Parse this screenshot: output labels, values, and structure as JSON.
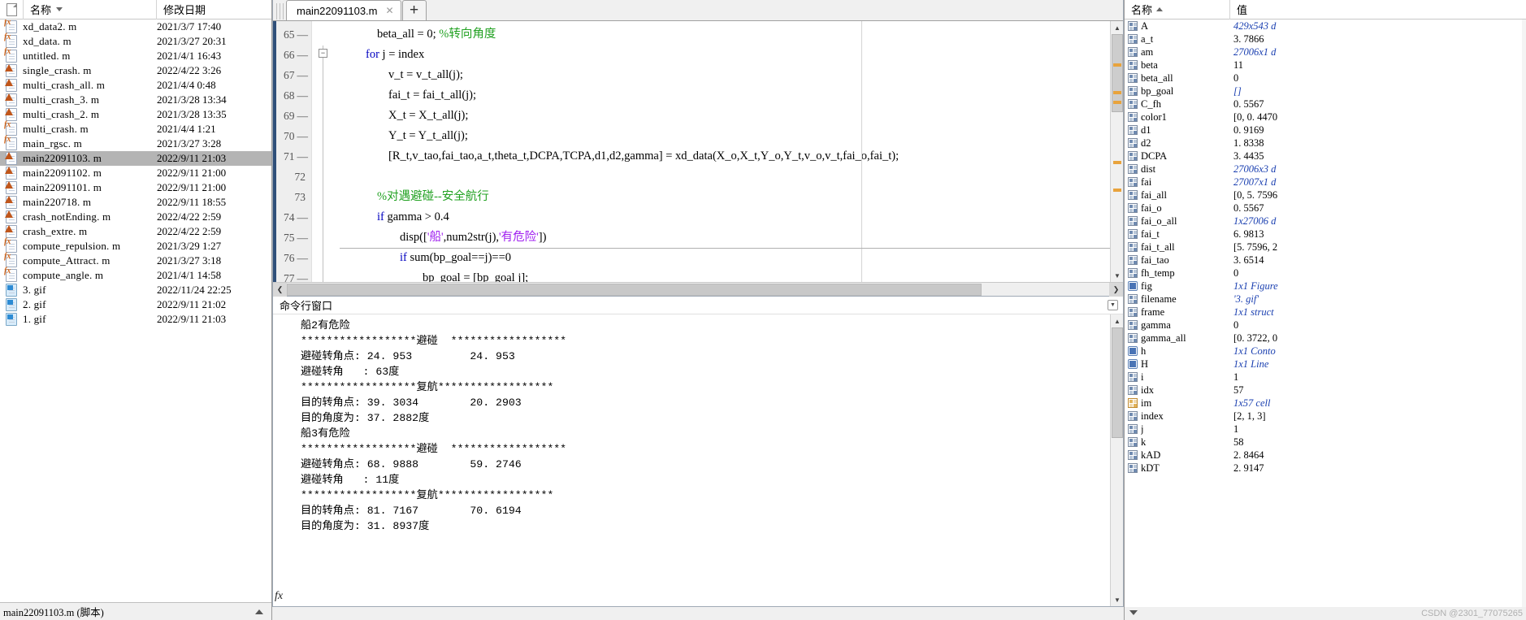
{
  "file_browser": {
    "columns": {
      "name": "名称",
      "date": "修改日期"
    },
    "files": [
      {
        "icon": "fx-file-icon",
        "name": "xd_data2. m",
        "date": "2021/3/7  17:40",
        "selected": false
      },
      {
        "icon": "fx-file-icon",
        "name": "xd_data. m",
        "date": "2021/3/27  20:31",
        "selected": false
      },
      {
        "icon": "fx-file-icon",
        "name": "untitled. m",
        "date": "2021/4/1  16:43",
        "selected": false
      },
      {
        "icon": "m-script-icon",
        "name": "single_crash. m",
        "date": "2022/4/22  3:26",
        "selected": false
      },
      {
        "icon": "m-script-icon",
        "name": "multi_crash_all. m",
        "date": "2021/4/4  0:48",
        "selected": false
      },
      {
        "icon": "m-script-icon",
        "name": "multi_crash_3. m",
        "date": "2021/3/28  13:34",
        "selected": false
      },
      {
        "icon": "m-script-icon",
        "name": "multi_crash_2. m",
        "date": "2021/3/28  13:35",
        "selected": false
      },
      {
        "icon": "fx-file-icon",
        "name": "multi_crash. m",
        "date": "2021/4/4  1:21",
        "selected": false
      },
      {
        "icon": "fx-file-icon",
        "name": "main_rgsc. m",
        "date": "2021/3/27  3:28",
        "selected": false
      },
      {
        "icon": "m-script-icon",
        "name": "main22091103. m",
        "date": "2022/9/11  21:03",
        "selected": true
      },
      {
        "icon": "m-script-icon",
        "name": "main22091102. m",
        "date": "2022/9/11  21:00",
        "selected": false
      },
      {
        "icon": "m-script-icon",
        "name": "main22091101. m",
        "date": "2022/9/11  21:00",
        "selected": false
      },
      {
        "icon": "m-script-icon",
        "name": "main220718. m",
        "date": "2022/9/11  18:55",
        "selected": false
      },
      {
        "icon": "m-script-icon",
        "name": "crash_notEnding. m",
        "date": "2022/4/22  2:59",
        "selected": false
      },
      {
        "icon": "m-script-icon",
        "name": "crash_extre. m",
        "date": "2022/4/22  2:59",
        "selected": false
      },
      {
        "icon": "fx-file-icon",
        "name": "compute_repulsion. m",
        "date": "2021/3/29  1:27",
        "selected": false
      },
      {
        "icon": "fx-file-icon",
        "name": "compute_Attract. m",
        "date": "2021/3/27  3:18",
        "selected": false
      },
      {
        "icon": "fx-file-icon",
        "name": "compute_angle. m",
        "date": "2021/4/1  14:58",
        "selected": false
      },
      {
        "icon": "gif-file-icon",
        "name": "3. gif",
        "date": "2022/11/24  22:25",
        "selected": false
      },
      {
        "icon": "gif-file-icon",
        "name": "2. gif",
        "date": "2022/9/11  21:02",
        "selected": false
      },
      {
        "icon": "gif-file-icon",
        "name": "1. gif",
        "date": "2022/9/11  21:03",
        "selected": false
      }
    ],
    "status": "main22091103.m (脚本)"
  },
  "editor": {
    "tab_label": "main22091103.m",
    "tab_close_glyph": "✕",
    "new_tab_glyph": "+",
    "lines": [
      {
        "num": "65",
        "dash": "—",
        "indent": 46,
        "segments": [
          {
            "t": "beta_all = 0; ",
            "c": "plain"
          },
          {
            "t": "%转向角度",
            "c": "cmt"
          }
        ]
      },
      {
        "num": "66",
        "dash": "—",
        "indent": 32,
        "segments": [
          {
            "t": "for",
            "c": "kw"
          },
          {
            "t": " j = index",
            "c": "plain"
          }
        ]
      },
      {
        "num": "67",
        "dash": "—",
        "indent": 60,
        "segments": [
          {
            "t": "v_t = v_t_all(j);",
            "c": "plain"
          }
        ]
      },
      {
        "num": "68",
        "dash": "—",
        "indent": 60,
        "segments": [
          {
            "t": "fai_t = fai_t_all(j);",
            "c": "plain"
          }
        ]
      },
      {
        "num": "69",
        "dash": "—",
        "indent": 60,
        "segments": [
          {
            "t": "X_t = X_t_all(j);",
            "c": "plain"
          }
        ]
      },
      {
        "num": "70",
        "dash": "—",
        "indent": 60,
        "segments": [
          {
            "t": "Y_t = Y_t_all(j);",
            "c": "plain"
          }
        ]
      },
      {
        "num": "71",
        "dash": "—",
        "indent": 60,
        "segments": [
          {
            "t": "[R_t,v_tao,fai_tao,a_t,theta_t,DCPA,TCPA,d1,d2,gamma] =  xd_data(X_o,X_t,Y_o,Y_t,v_o,v_t,fai_o,fai_t);",
            "c": "plain"
          }
        ]
      },
      {
        "num": "72",
        "dash": "",
        "indent": 60,
        "segments": [
          {
            "t": "",
            "c": "plain"
          }
        ]
      },
      {
        "num": "73",
        "dash": "",
        "indent": 46,
        "segments": [
          {
            "t": "%对遇避碰--安全航行",
            "c": "cmt"
          }
        ]
      },
      {
        "num": "74",
        "dash": "—",
        "indent": 46,
        "segments": [
          {
            "t": "if",
            "c": "kw"
          },
          {
            "t": " gamma > 0.4",
            "c": "plain"
          }
        ]
      },
      {
        "num": "75",
        "dash": "—",
        "indent": 74,
        "segments": [
          {
            "t": "disp([",
            "c": "plain"
          },
          {
            "t": "'船'",
            "c": "str"
          },
          {
            "t": ",num2str(j),",
            "c": "plain"
          },
          {
            "t": "'有危险'",
            "c": "str"
          },
          {
            "t": "])",
            "c": "plain"
          }
        ]
      },
      {
        "num": "76",
        "dash": "—",
        "indent": 74,
        "segments": [
          {
            "t": "if",
            "c": "kw"
          },
          {
            "t": " sum(bp_goal==j)==0",
            "c": "plain"
          }
        ]
      },
      {
        "num": "77",
        "dash": "—",
        "indent": 102,
        "segments": [
          {
            "t": "bp_goal",
            "c": "under"
          },
          {
            "t": " = [bp_goal j];",
            "c": "plain"
          }
        ]
      }
    ],
    "fold_glyph": "−",
    "scroll_up_glyph": "▲",
    "scroll_down_glyph": "▼",
    "hscroll_left_glyph": "❮",
    "hscroll_right_glyph": "❯"
  },
  "command_window": {
    "title": "命令行窗口",
    "prompt_glyph": "fx",
    "output": [
      "船2有危险",
      "******************避碰  ******************",
      "避碰转角点: 24. 953         24. 953",
      "避碰转角   : 63度",
      "******************复航******************",
      "目的转角点: 39. 3034        20. 2903",
      "目的角度为: 37. 2882度",
      "船3有危险",
      "******************避碰  ******************",
      "避碰转角点: 68. 9888        59. 2746",
      "避碰转角   : 11度",
      "******************复航******************",
      "目的转角点: 81. 7167        70. 6194",
      "目的角度为: 31. 8937度"
    ]
  },
  "workspace": {
    "columns": {
      "name": "名称",
      "value": "值"
    },
    "variables": [
      {
        "icon": "matrix-icon",
        "name": "A",
        "value": "429x543 d",
        "italic": true
      },
      {
        "icon": "matrix-icon",
        "name": "a_t",
        "value": "3. 7866",
        "italic": false
      },
      {
        "icon": "matrix-icon",
        "name": "am",
        "value": "27006x1 d",
        "italic": true
      },
      {
        "icon": "matrix-icon",
        "name": "beta",
        "value": "11",
        "italic": false
      },
      {
        "icon": "matrix-icon",
        "name": "beta_all",
        "value": "0",
        "italic": false
      },
      {
        "icon": "matrix-icon",
        "name": "bp_goal",
        "value": "[]",
        "italic": true
      },
      {
        "icon": "matrix-icon",
        "name": "C_fh",
        "value": "0. 5567",
        "italic": false
      },
      {
        "icon": "matrix-icon",
        "name": "color1",
        "value": "[0, 0. 4470",
        "italic": false
      },
      {
        "icon": "matrix-icon",
        "name": "d1",
        "value": "0. 9169",
        "italic": false
      },
      {
        "icon": "matrix-icon",
        "name": "d2",
        "value": "1. 8338",
        "italic": false
      },
      {
        "icon": "matrix-icon",
        "name": "DCPA",
        "value": "3. 4435",
        "italic": false
      },
      {
        "icon": "matrix-icon",
        "name": "dist",
        "value": "27006x3 d",
        "italic": true
      },
      {
        "icon": "matrix-icon",
        "name": "fai",
        "value": "27007x1 d",
        "italic": true
      },
      {
        "icon": "matrix-icon",
        "name": "fai_all",
        "value": "[0, 5. 7596",
        "italic": false
      },
      {
        "icon": "matrix-icon",
        "name": "fai_o",
        "value": "0. 5567",
        "italic": false
      },
      {
        "icon": "matrix-icon",
        "name": "fai_o_all",
        "value": "1x27006 d",
        "italic": true
      },
      {
        "icon": "matrix-icon",
        "name": "fai_t",
        "value": "6. 9813",
        "italic": false
      },
      {
        "icon": "matrix-icon",
        "name": "fai_t_all",
        "value": "[5. 7596, 2",
        "italic": false
      },
      {
        "icon": "matrix-icon",
        "name": "fai_tao",
        "value": "3. 6514",
        "italic": false
      },
      {
        "icon": "matrix-icon",
        "name": "fh_temp",
        "value": "0",
        "italic": false
      },
      {
        "icon": "object-icon",
        "name": "fig",
        "value": "1x1 Figure",
        "italic": true
      },
      {
        "icon": "matrix-icon",
        "name": "filename",
        "value": "'3. gif'",
        "italic": true
      },
      {
        "icon": "matrix-icon",
        "name": "frame",
        "value": "1x1 struct",
        "italic": true
      },
      {
        "icon": "matrix-icon",
        "name": "gamma",
        "value": "0",
        "italic": false
      },
      {
        "icon": "matrix-icon",
        "name": "gamma_all",
        "value": "[0. 3722, 0",
        "italic": false
      },
      {
        "icon": "object-icon",
        "name": "h",
        "value": "1x1 Conto",
        "italic": true
      },
      {
        "icon": "object-icon",
        "name": "H",
        "value": "1x1 Line",
        "italic": true
      },
      {
        "icon": "matrix-icon",
        "name": "i",
        "value": "1",
        "italic": false
      },
      {
        "icon": "matrix-icon",
        "name": "idx",
        "value": "57",
        "italic": false
      },
      {
        "icon": "cell-icon",
        "name": "im",
        "value": "1x57 cell",
        "italic": true
      },
      {
        "icon": "matrix-icon",
        "name": "index",
        "value": "[2, 1, 3]",
        "italic": false
      },
      {
        "icon": "matrix-icon",
        "name": "j",
        "value": "1",
        "italic": false
      },
      {
        "icon": "matrix-icon",
        "name": "k",
        "value": "58",
        "italic": false
      },
      {
        "icon": "matrix-icon",
        "name": "kAD",
        "value": "2. 8464",
        "italic": false
      },
      {
        "icon": "matrix-icon",
        "name": "kDT",
        "value": "2. 9147",
        "italic": false
      }
    ]
  },
  "watermark": "CSDN @2301_77075265"
}
